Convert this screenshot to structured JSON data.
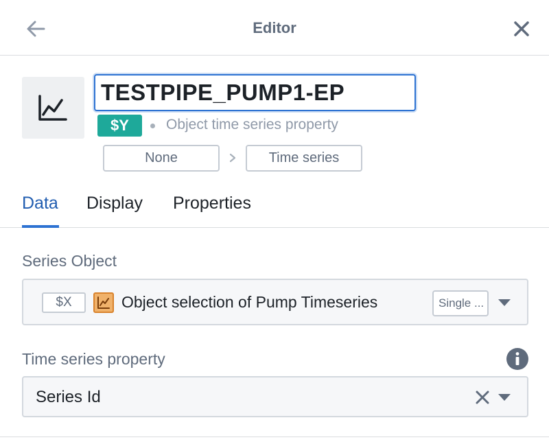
{
  "header": {
    "title": "Editor",
    "back_icon": "arrow-left-icon",
    "close_icon": "close-icon"
  },
  "series": {
    "icon": "line-chart-icon",
    "name_value": "TESTPIPE_PUMP1-EP",
    "variable_badge": "$Y",
    "type_label": "Object time series property",
    "breadcrumb": {
      "from": "None",
      "to": "Time series"
    }
  },
  "tabs": [
    {
      "label": "Data",
      "active": true
    },
    {
      "label": "Display",
      "active": false
    },
    {
      "label": "Properties",
      "active": false
    }
  ],
  "data_tab": {
    "series_object": {
      "label": "Series Object",
      "variable_tag": "$X",
      "object_icon": "line-chart-icon",
      "value": "Object selection of Pump Timeseries",
      "mode": "Single ..."
    },
    "time_series_property": {
      "label": "Time series property",
      "info_icon": "info-icon",
      "value": "Series Id"
    }
  },
  "colors": {
    "accent": "#2d72d2",
    "badge": "#1ea99a",
    "object_icon": "#f0b26b",
    "muted_text": "#5f6b7c"
  }
}
